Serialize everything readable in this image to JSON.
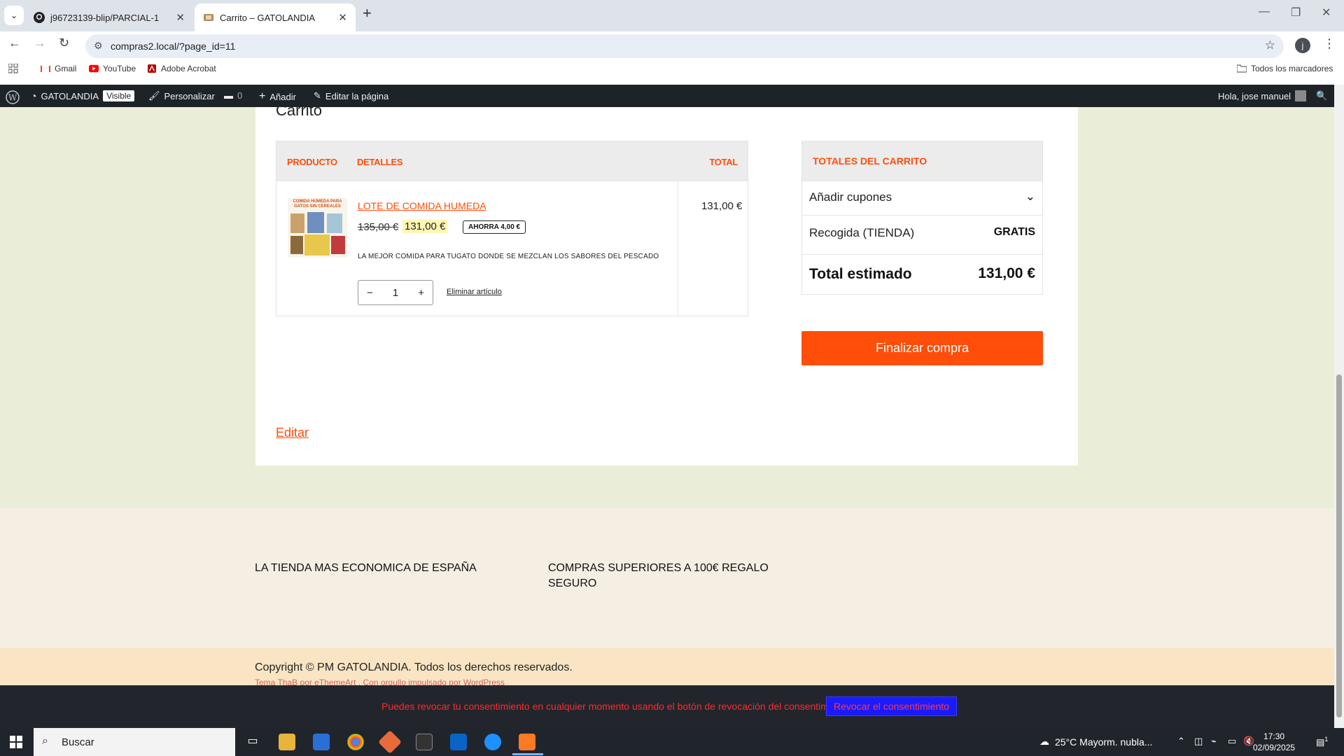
{
  "browser": {
    "tabs": [
      {
        "title": "j96723139-blip/PARCIAL-1",
        "active": false,
        "icon": "github-icon"
      },
      {
        "title": "Carrito – GATOLANDIA",
        "active": true,
        "icon": "site-favicon"
      }
    ],
    "url": "compras2.local/?page_id=11",
    "profile_initial": "j",
    "bookmarks": [
      {
        "label": "Gmail",
        "icon": "gmail-icon"
      },
      {
        "label": "YouTube",
        "icon": "youtube-icon"
      },
      {
        "label": "Adobe Acrobat",
        "icon": "acrobat-icon"
      }
    ],
    "all_bookmarks": "Todos los marcadores"
  },
  "wp_admin": {
    "site_name": "GATOLANDIA",
    "visible_badge": "Visible",
    "customize": "Personalizar",
    "comments_count": "0",
    "add": "Añadir",
    "edit_page": "Editar la página",
    "greeting": "Hola, jose manuel"
  },
  "cart": {
    "title": "Carrito",
    "headers": {
      "product": "PRODUCTO",
      "details": "DETALLES",
      "total": "TOTAL"
    },
    "item": {
      "thumb_text": "COMIDA HÚMEDA PARA GATOS SIN CEREALES",
      "name": "LOTE DE COMIDA HUMEDA",
      "old_price": "135,00 €",
      "new_price": "131,00 €",
      "savings": "AHORRA 4,00 €",
      "description": "LA MEJOR COMIDA PARA TUGATO DONDE SE MEZCLAN LOS SABORES DEL PESCADO",
      "quantity": "1",
      "minus": "−",
      "plus": "+",
      "remove": "Eliminar artículo",
      "line_total": "131,00 €"
    },
    "edit_link": "Editar"
  },
  "totals": {
    "title": "TOTALES DEL CARRITO",
    "coupons": "Añadir cupones",
    "pickup_label": "Recogida (TIENDA)",
    "pickup_value": "GRATIS",
    "estimated_label": "Total estimado",
    "estimated_value": "131,00 €",
    "checkout": "Finalizar compra"
  },
  "footer": {
    "col1": "LA TIENDA MAS ECONOMICA DE ESPAÑA",
    "col2": "COMPRAS SUPERIORES A 100€ REGALO SEGURO",
    "copyright": "Copyright © PM GATOLANDIA. Todos los derechos reservados.",
    "credit": "Tema ThaB por eThemeArt . Con orgullo impulsado por WordPress"
  },
  "consent": {
    "text": "Puedes revocar tu consentimiento en cualquier momento usando el botón de revocación del consentimiento.",
    "button": "Revocar el consentimiento"
  },
  "taskbar": {
    "search": "Buscar",
    "weather": "25°C  Mayorm. nubla...",
    "time": "17:30",
    "date": "02/09/2025",
    "notifications": "1"
  },
  "colors": {
    "accent": "#ff4d0a",
    "page_bg": "#eaeed8",
    "wp_bar": "#1d2327"
  }
}
